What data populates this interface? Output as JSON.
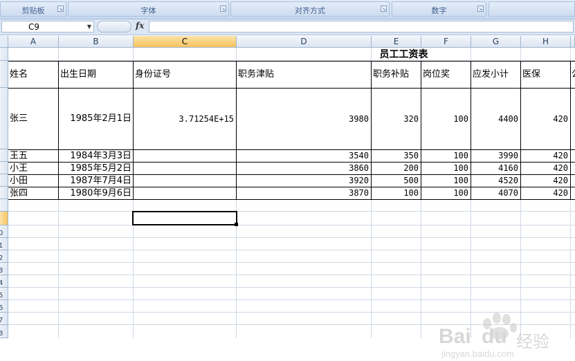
{
  "ribbon": {
    "groups": [
      {
        "label": "剪贴板"
      },
      {
        "label": "字体"
      },
      {
        "label": "对齐方式"
      },
      {
        "label": "数字"
      }
    ]
  },
  "formula_bar": {
    "name_box": "C9",
    "fx_label": "fx",
    "formula": ""
  },
  "columns": [
    "A",
    "B",
    "C",
    "D",
    "E",
    "F",
    "G",
    "H"
  ],
  "selected_column": "C",
  "row_numbers_visible": [
    "0",
    "1",
    "2",
    "3",
    "4",
    "5",
    "6",
    "7",
    "8"
  ],
  "sheet": {
    "title": "员工工资表",
    "headers": [
      "姓名",
      "出生日期",
      "身份证号",
      "职务津贴",
      "职务补贴",
      "岗位奖",
      "应发小计",
      "医保"
    ],
    "rows": [
      [
        "张三",
        "1985年2月1日",
        "3.71254E+15",
        "3980",
        "320",
        "100",
        "4400",
        "420"
      ],
      [
        "王五",
        "1984年3月3日",
        "",
        "3540",
        "350",
        "100",
        "3990",
        "420"
      ],
      [
        "小王",
        "1985年5月2日",
        "",
        "3860",
        "200",
        "100",
        "4160",
        "420"
      ],
      [
        "小田",
        "1987年7月4日",
        "",
        "3920",
        "500",
        "100",
        "4520",
        "420"
      ],
      [
        "张四",
        "1980年9月6日",
        "",
        "3870",
        "100",
        "100",
        "4070",
        "420"
      ]
    ]
  },
  "watermark": {
    "brand": "Bai",
    "brand2": "du",
    "cn": "经验",
    "url": "jingyan.baidu.com"
  }
}
